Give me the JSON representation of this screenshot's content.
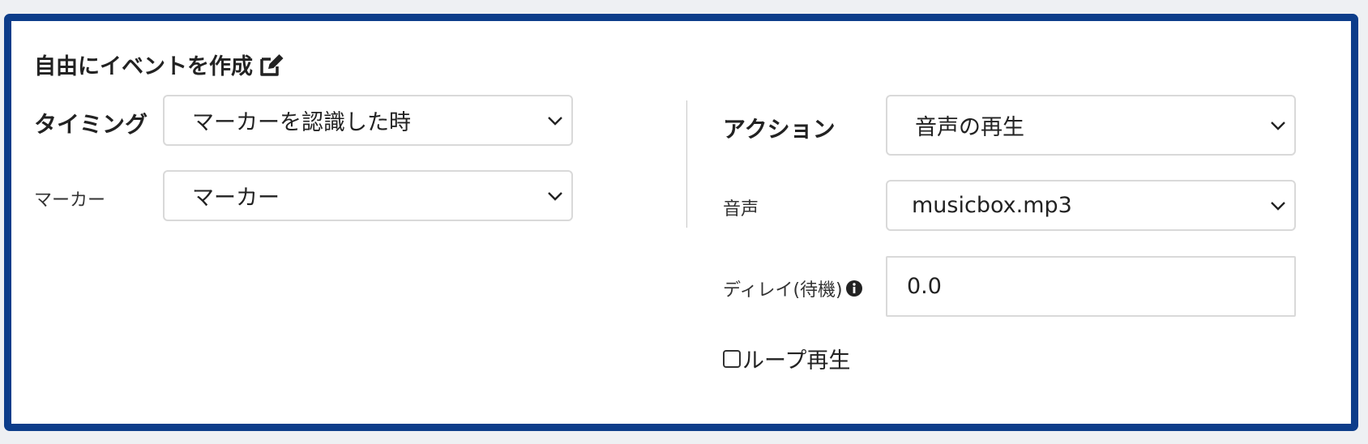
{
  "header": {
    "title": "自由にイベントを作成",
    "icon": "edit-icon"
  },
  "left": {
    "timing_label": "タイミング",
    "timing_value": "マーカーを認識した時",
    "marker_label": "マーカー",
    "marker_value": "マーカー"
  },
  "right": {
    "action_label": "アクション",
    "action_value": "音声の再生",
    "sound_label": "音声",
    "sound_value": "musicbox.mp3",
    "delay_label": "ディレイ(待機)",
    "delay_value": "0.0",
    "loop_label": "ループ再生",
    "loop_checked": false
  },
  "colors": {
    "panel_border": "#0d3d8a",
    "field_border": "#d9d9d9",
    "background": "#eef0f3"
  }
}
